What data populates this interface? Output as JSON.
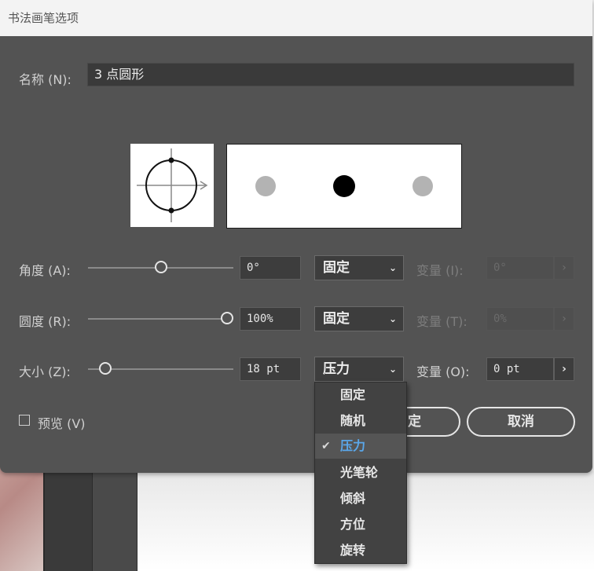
{
  "dialog": {
    "title": "书法画笔选项"
  },
  "name": {
    "label": "名称 (N):",
    "value": "3 点圆形"
  },
  "angle": {
    "label": "角度 (A):",
    "value": "0°",
    "mode": "固定",
    "variation_label": "变量 (I):",
    "variation_value": "0°"
  },
  "roundness": {
    "label": "圆度 (R):",
    "value": "100%",
    "mode": "固定",
    "variation_label": "变量 (T):",
    "variation_value": "0%"
  },
  "size": {
    "label": "大小 (Z):",
    "value": "18 pt",
    "mode": "压力",
    "variation_label": "变量 (O):",
    "variation_value": "0 pt"
  },
  "preview": {
    "label": "预览 (V)",
    "checked": false
  },
  "buttons": {
    "ok": "确定",
    "ok_visible": "定",
    "cancel": "取消"
  },
  "dropdown": {
    "items": [
      "固定",
      "随机",
      "压力",
      "光笔轮",
      "倾斜",
      "方位",
      "旋转"
    ],
    "selected_index": 2
  },
  "icons": {
    "chevron": "chevron-down-icon",
    "stepper": "chevron-right-icon",
    "check": "checkmark-icon"
  },
  "colors": {
    "dialog_bg": "#535353",
    "accent": "#5aa7ea"
  }
}
